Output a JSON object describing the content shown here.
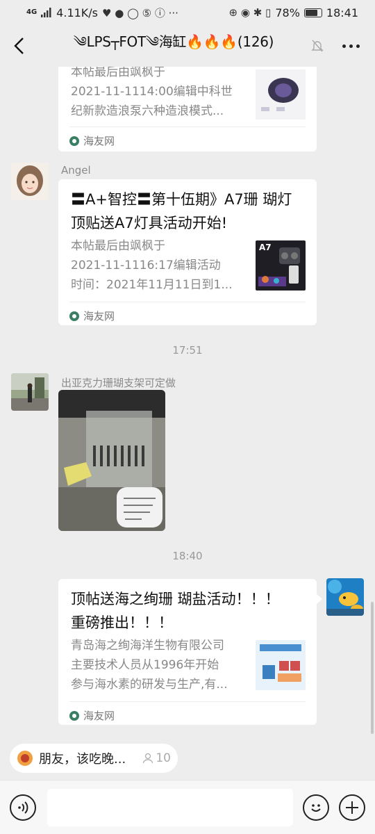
{
  "status_bar": {
    "signal": "4G",
    "speed": "4.11K/s",
    "battery": "78%",
    "battery_level": 0.78,
    "time": "18:41"
  },
  "header": {
    "title": "༄LPS┬FOT༄海缸🔥🔥🔥(126)"
  },
  "messages": [
    {
      "type": "link_card",
      "title_lines": [],
      "desc_lines": [
        "本帖最后由飒枫于",
        "2021-11-1114:00编辑中科世",
        "纪新款造浪泵六种造浪模式..."
      ],
      "source": "海友网"
    },
    {
      "sender": "Angel",
      "type": "link_card",
      "title_lines": [
        "〓A+智控〓第十伍期》A7珊 瑚灯",
        "顶贴送A7灯具活动开始!"
      ],
      "desc_lines": [
        "本帖最后由飒枫于",
        "2021-11-1116:17编辑活动",
        "时间：2021年11月11日到1..."
      ],
      "thumb_label": "A7",
      "source": "海友网"
    },
    {
      "type": "time",
      "text": "17:51"
    },
    {
      "sender": "出亚克力珊瑚支架可定做",
      "type": "image"
    },
    {
      "type": "time",
      "text": "18:40"
    },
    {
      "type": "link_card",
      "self": true,
      "title_lines": [
        "顶帖送海之绚珊 瑚盐活动！！！",
        "重磅推出！！！"
      ],
      "desc_lines": [
        "青岛海之绚海洋生物有限公司",
        "主要技术人员从1996年开始",
        "参与海水素的研发与生产,有..."
      ],
      "source": "海友网"
    }
  ],
  "notice": {
    "text": "朋友，该吃晚...",
    "count": "10"
  },
  "icons": [
    "back-icon",
    "mute-icon",
    "more-icon",
    "voice-icon",
    "emoji-icon",
    "plus-icon"
  ],
  "colors": {
    "bg": "#ededed",
    "card": "#ffffff",
    "source_icon": "#3a7f63"
  }
}
